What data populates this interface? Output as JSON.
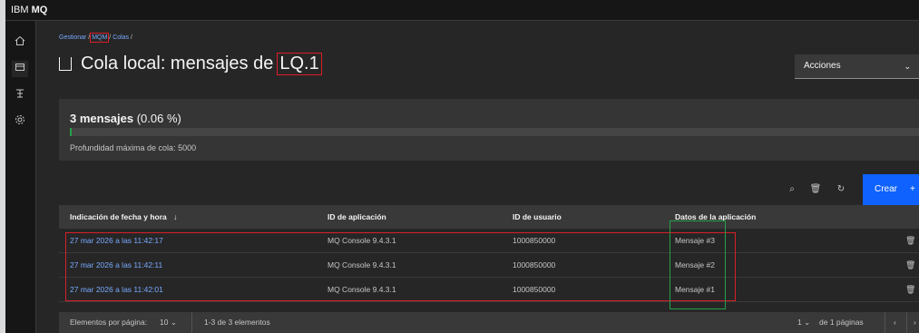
{
  "app": {
    "brand_prefix": "IBM",
    "brand_name": "MQ"
  },
  "sidenav": {
    "items": [
      "home-icon",
      "queue-manager-icon",
      "channel-icon",
      "settings-icon"
    ]
  },
  "breadcrumb": {
    "item1": "Gestionar",
    "item2": "MQM",
    "item3": "Colas",
    "sep": "/"
  },
  "title": {
    "prefix": "Cola local: mensajes de",
    "queue": "LQ.1"
  },
  "actions": {
    "label": "Acciones",
    "chevron": "⌄"
  },
  "summary": {
    "count_bold": "3 mensajes",
    "count_pct": " (0.06 %)",
    "depth_fraction": 0.0006,
    "max_depth_text": "Profundidad máxima de cola: 5000"
  },
  "toolbar": {
    "search_icon": "⌕",
    "delete_icon": "🗑",
    "refresh_icon": "↻",
    "create_label": "Crear",
    "create_plus": "+"
  },
  "table": {
    "headers": {
      "timestamp": "Indicación de fecha y hora",
      "sort_icon": "↓",
      "app_id": "ID de aplicación",
      "user_id": "ID de usuario",
      "app_data": "Datos de la aplicación"
    },
    "rows": [
      {
        "timestamp": "27 mar 2026 a las 11:42:17",
        "app_id": "MQ Console 9.4.3.1",
        "user_id": "1000850000",
        "data": "Mensaje #3"
      },
      {
        "timestamp": "27 mar 2026 a las 11:42:11",
        "app_id": "MQ Console 9.4.3.1",
        "user_id": "1000850000",
        "data": "Mensaje #2"
      },
      {
        "timestamp": "27 mar 2026 a las 11:42:01",
        "app_id": "MQ Console 9.4.3.1",
        "user_id": "1000850000",
        "data": "Mensaje #1"
      }
    ],
    "row_delete_icon": "🗑"
  },
  "pagination": {
    "per_page_label": "Elementos por página:",
    "per_page_value": "10",
    "range_text": "1-3 de 3 elementos",
    "page_value": "1",
    "pages_text": "de 1 páginas",
    "chevron": "⌄",
    "prev_icon": "‹",
    "next_icon": "›"
  },
  "colors": {
    "accent": "#0f62fe",
    "link": "#78a9ff",
    "highlight_red": "#da1e28",
    "highlight_green": "#24a148"
  }
}
